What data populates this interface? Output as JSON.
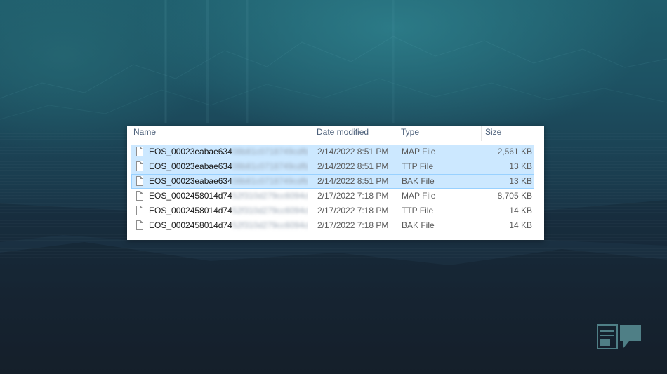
{
  "columns": {
    "name": "Name",
    "date": "Date modified",
    "type": "Type",
    "size": "Size"
  },
  "files": [
    {
      "name_visible": "EOS_00023eabae634",
      "name_obscured": "08b81c0718749cdfb7...",
      "date": "2/14/2022 8:51 PM",
      "type": "MAP File",
      "size": "2,561 KB",
      "selected": true,
      "focused": false
    },
    {
      "name_visible": "EOS_00023eabae634",
      "name_obscured": "08b81c0718749cdfb7...",
      "date": "2/14/2022 8:51 PM",
      "type": "TTP File",
      "size": "13 KB",
      "selected": true,
      "focused": false
    },
    {
      "name_visible": "EOS_00023eabae634",
      "name_obscured": "08b81c0718749cdfb7...",
      "date": "2/14/2022 8:51 PM",
      "type": "BAK File",
      "size": "13 KB",
      "selected": true,
      "focused": true
    },
    {
      "name_visible": "EOS_0002458014d74",
      "name_obscured": "52f310d279cc6094c61...",
      "date": "2/17/2022 7:18 PM",
      "type": "MAP File",
      "size": "8,705 KB",
      "selected": false,
      "focused": false
    },
    {
      "name_visible": "EOS_0002458014d74",
      "name_obscured": "52f310d279cc6094c61...",
      "date": "2/17/2022 7:18 PM",
      "type": "TTP File",
      "size": "14 KB",
      "selected": false,
      "focused": false
    },
    {
      "name_visible": "EOS_0002458014d74",
      "name_obscured": "52f310d279cc6094c61...",
      "date": "2/17/2022 7:18 PM",
      "type": "BAK File",
      "size": "14 KB",
      "selected": false,
      "focused": false
    }
  ],
  "colors": {
    "selection": "#cce8ff",
    "focus_border": "#99d1ff",
    "header_text": "#4c607a"
  },
  "icons": {
    "file": "file-icon",
    "logo": "site-logo-icon"
  }
}
